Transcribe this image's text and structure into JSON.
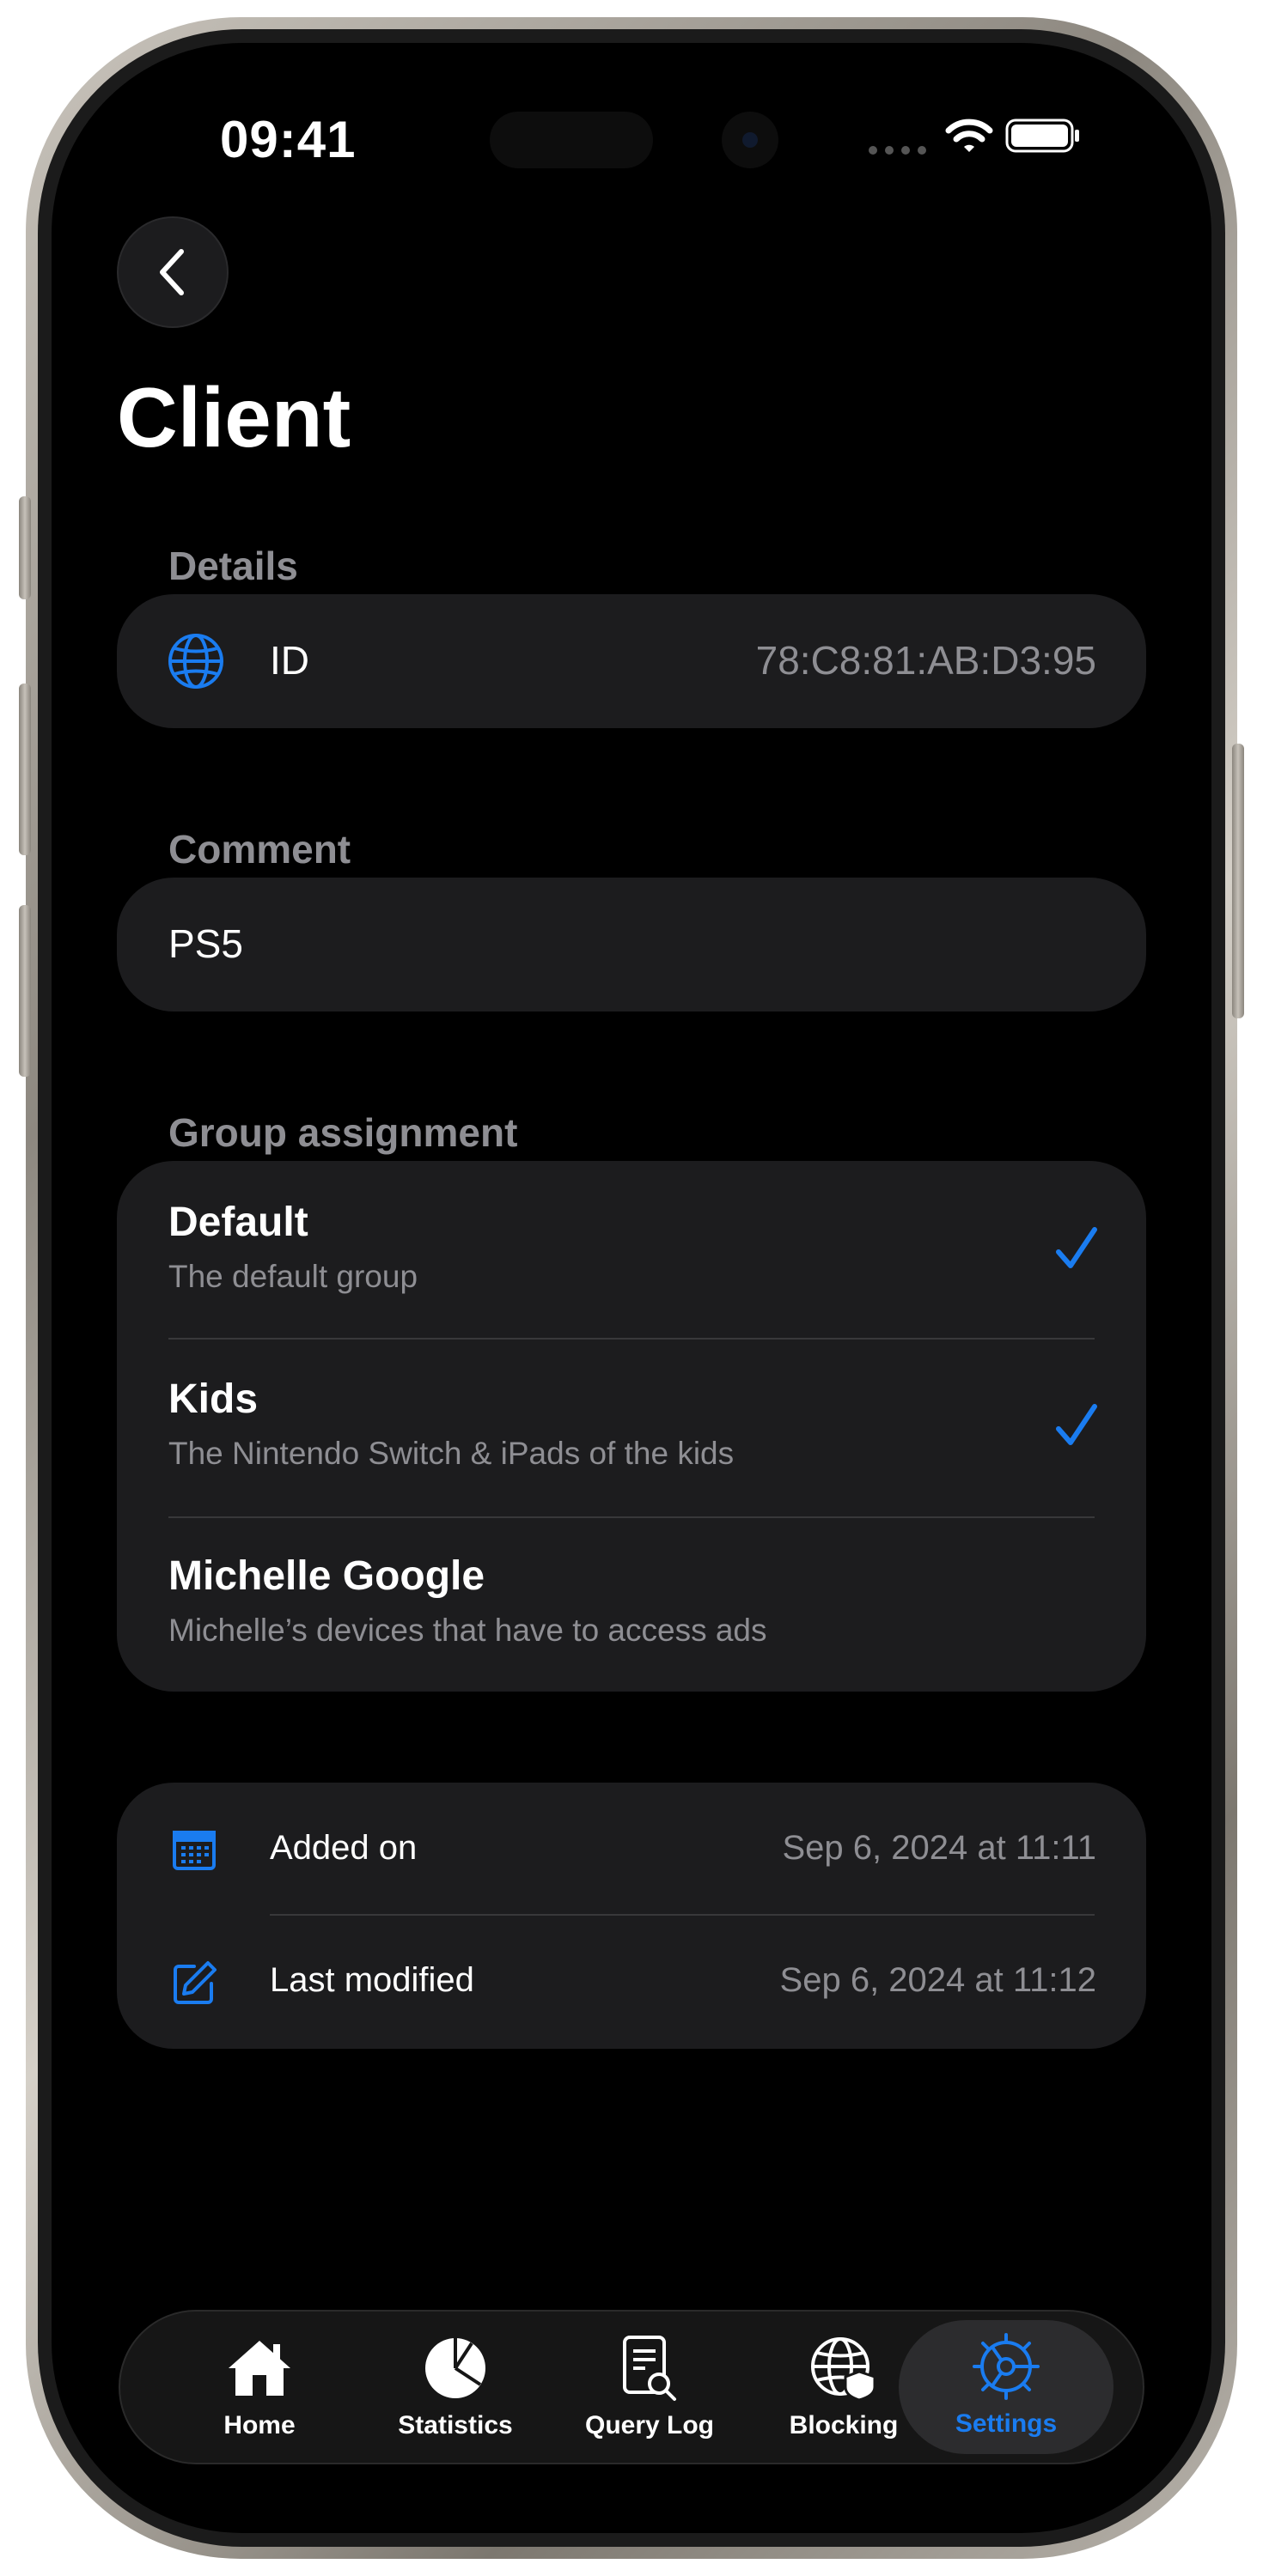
{
  "status_bar": {
    "time": "09:41"
  },
  "page": {
    "title": "Client"
  },
  "details": {
    "section_label": "Details",
    "id_label": "ID",
    "id_value": "78:C8:81:AB:D3:95"
  },
  "comment": {
    "section_label": "Comment",
    "value": "PS5"
  },
  "groups": {
    "section_label": "Group assignment",
    "items": [
      {
        "name": "Default",
        "description": "The default group",
        "selected": true
      },
      {
        "name": "Kids",
        "description": "The Nintendo Switch & iPads of the kids",
        "selected": true
      },
      {
        "name": "Michelle Google",
        "description": "Michelle’s devices that have to access ads",
        "selected": false
      }
    ]
  },
  "meta": {
    "added_label": "Added on",
    "added_value": "Sep 6, 2024 at 11:11",
    "modified_label": "Last modified",
    "modified_value": "Sep 6, 2024 at 11:12"
  },
  "tabs": [
    {
      "label": "Home",
      "icon": "house-icon"
    },
    {
      "label": "Statistics",
      "icon": "pie-chart-icon"
    },
    {
      "label": "Query Log",
      "icon": "doc-magnifier-icon"
    },
    {
      "label": "Blocking",
      "icon": "globe-shield-icon"
    },
    {
      "label": "Settings",
      "icon": "gear-icon",
      "active": true
    }
  ],
  "colors": {
    "accent": "#1a7cf0",
    "background": "#000000",
    "card": "#1c1c1e",
    "secondary_text": "#8e8e93"
  }
}
